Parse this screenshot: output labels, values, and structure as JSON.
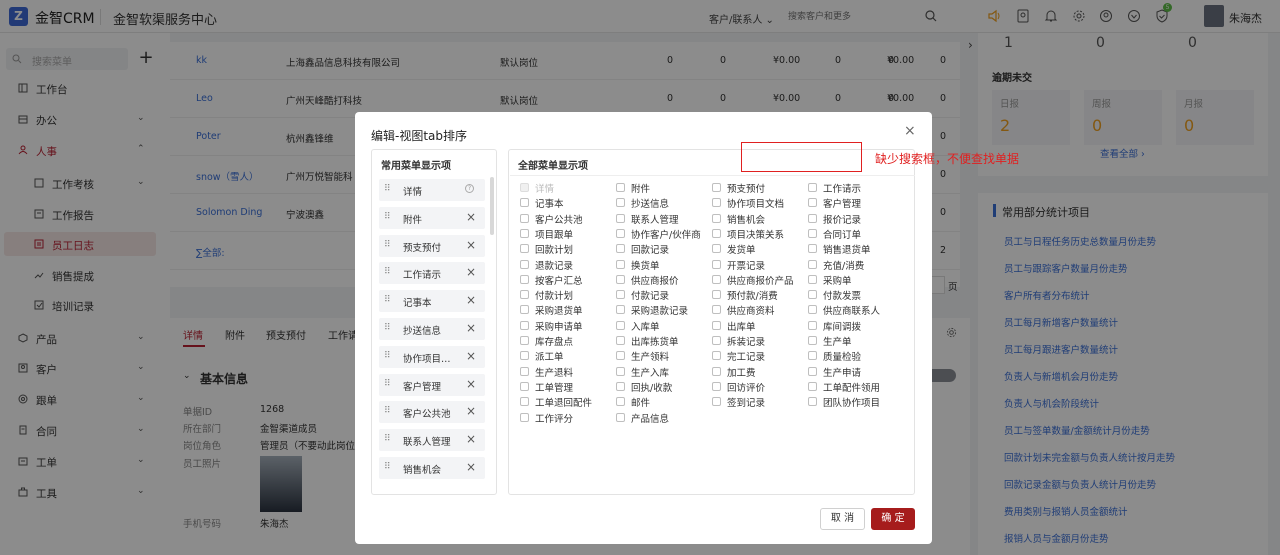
{
  "topbar": {
    "logo_letter": "Z",
    "app_title": "金智CRM",
    "org_title": "金智软渠服务中心",
    "search_scope": "客户/联系人 ⌄",
    "search_placeholder": "搜索客户和更多",
    "badge_count": "5",
    "user_name": "朱海杰"
  },
  "sidebar": {
    "search_placeholder": "搜索菜单",
    "items": [
      {
        "label": "工作台"
      },
      {
        "label": "办公",
        "chev": "⌄"
      },
      {
        "label": "人事",
        "chev": "⌃"
      },
      {
        "label": "工作考核",
        "chev": "⌄"
      },
      {
        "label": "工作报告"
      },
      {
        "label": "员工日志"
      },
      {
        "label": "销售提成"
      },
      {
        "label": "培训记录"
      },
      {
        "label": "产品",
        "chev": "⌄"
      },
      {
        "label": "客户",
        "chev": "⌄"
      },
      {
        "label": "跟单",
        "chev": "⌄"
      },
      {
        "label": "合同",
        "chev": "⌄"
      },
      {
        "label": "工单",
        "chev": "⌄"
      },
      {
        "label": "工具",
        "chev": "⌄"
      }
    ]
  },
  "table": {
    "rows": [
      [
        "kk",
        "上海鑫品信息科技有限公司",
        "默认岗位",
        "0",
        "0",
        "¥0.00",
        "0",
        "0",
        "¥0.00",
        "0"
      ],
      [
        "Leo",
        "广州天峰酷打科技",
        "默认岗位",
        "0",
        "0",
        "¥0.00",
        "0",
        "0",
        "¥0.00",
        "0"
      ],
      [
        "Poter",
        "杭州鑫锋维",
        "",
        "",
        "",
        "",
        "",
        "",
        "",
        "0"
      ],
      [
        "snow（雪人）",
        "广州万悦智能科",
        "",
        "",
        "",
        "",
        "",
        "",
        "",
        "0"
      ],
      [
        "Solomon Ding",
        "宁波澳鑫",
        "",
        "",
        "",
        "",
        "",
        "",
        "",
        "0"
      ],
      [
        "∑全部:",
        "",
        "",
        "",
        "",
        "",
        "",
        "",
        "",
        "2"
      ]
    ],
    "pager_label": "页"
  },
  "detail": {
    "tabs": [
      "详情",
      "附件",
      "预支预付",
      "工作请"
    ],
    "section_title": "基本信息",
    "fields": [
      {
        "label": "单据ID",
        "value": "1268"
      },
      {
        "label": "所在部门",
        "value": "金智渠道成员"
      },
      {
        "label": "岗位角色",
        "value": "管理员（不要动此岗位"
      },
      {
        "label": "员工照片",
        "value": ""
      },
      {
        "label": "手机号码",
        "value": "朱海杰"
      }
    ]
  },
  "right": {
    "top_numbers": [
      "1",
      "0",
      "0"
    ],
    "overdue_title": "逾期未交",
    "overdue": [
      {
        "label": "日报",
        "value": "2"
      },
      {
        "label": "周报",
        "value": "0"
      },
      {
        "label": "月报",
        "value": "0"
      }
    ],
    "view_all": "查看全部 ›",
    "stats_title": "常用部分统计项目",
    "stats": [
      "员工与日程任务历史总数量月份走势",
      "员工与跟踪客户数量月份走势",
      "客户所有者分布统计",
      "员工每月新增客户数量统计",
      "员工每月跟进客户数量统计",
      "负责人与新增机会月份走势",
      "负责人与机会阶段统计",
      "员工与签单数量/金额统计月份走势",
      "回款计划未完金额与负责人统计按月走势",
      "回款记录金额与负责人统计月份走势",
      "费用类别与报销人员金额统计",
      "报销人员与金额月份走势"
    ]
  },
  "modal": {
    "title": "编辑-视图tab排序",
    "close": "×",
    "left_title": "常用菜单显示项",
    "left_items": [
      "详情",
      "附件",
      "预支预付",
      "工作请示",
      "记事本",
      "抄送信息",
      "协作项目文档",
      "客户管理",
      "客户公共池",
      "联系人管理",
      "销售机会"
    ],
    "right_title": "全部菜单显示项",
    "columns": [
      [
        "详情",
        "记事本",
        "客户公共池",
        "项目跟单",
        "回款计划",
        "退款记录",
        "按客户汇总",
        "付款计划",
        "采购退货单",
        "采购申请单",
        "库存盘点",
        "派工单",
        "生产退料",
        "工单管理",
        "工单退回配件",
        "工作评分"
      ],
      [
        "附件",
        "抄送信息",
        "联系人管理",
        "协作客户/伙伴商",
        "回款记录",
        "换货单",
        "供应商报价",
        "付款记录",
        "采购退款记录",
        "入库单",
        "出库拣货单",
        "生产领料",
        "生产入库",
        "回执/收款",
        "邮件",
        "产品信息"
      ],
      [
        "预支预付",
        "协作项目文档",
        "销售机会",
        "项目决策关系",
        "发货单",
        "开票记录",
        "供应商报价产品",
        "预付款/消费",
        "供应商资料",
        "出库单",
        "拆装记录",
        "完工记录",
        "加工费",
        "回访评价",
        "签到记录"
      ],
      [
        "工作请示",
        "客户管理",
        "报价记录",
        "合同订单",
        "销售退货单",
        "充值/消费",
        "采购单",
        "付款发票",
        "供应商联系人",
        "库间调拨",
        "生产单",
        "质量检验",
        "生产申请",
        "工单配件领用",
        "团队协作项目"
      ]
    ],
    "cancel": "取 消",
    "ok": "确 定"
  },
  "annotation": {
    "text": "缺少搜索框，不便查找单据"
  },
  "colors": {
    "accent": "#a61c1c",
    "link": "#3a6fd8",
    "annotation": "#e02020"
  }
}
